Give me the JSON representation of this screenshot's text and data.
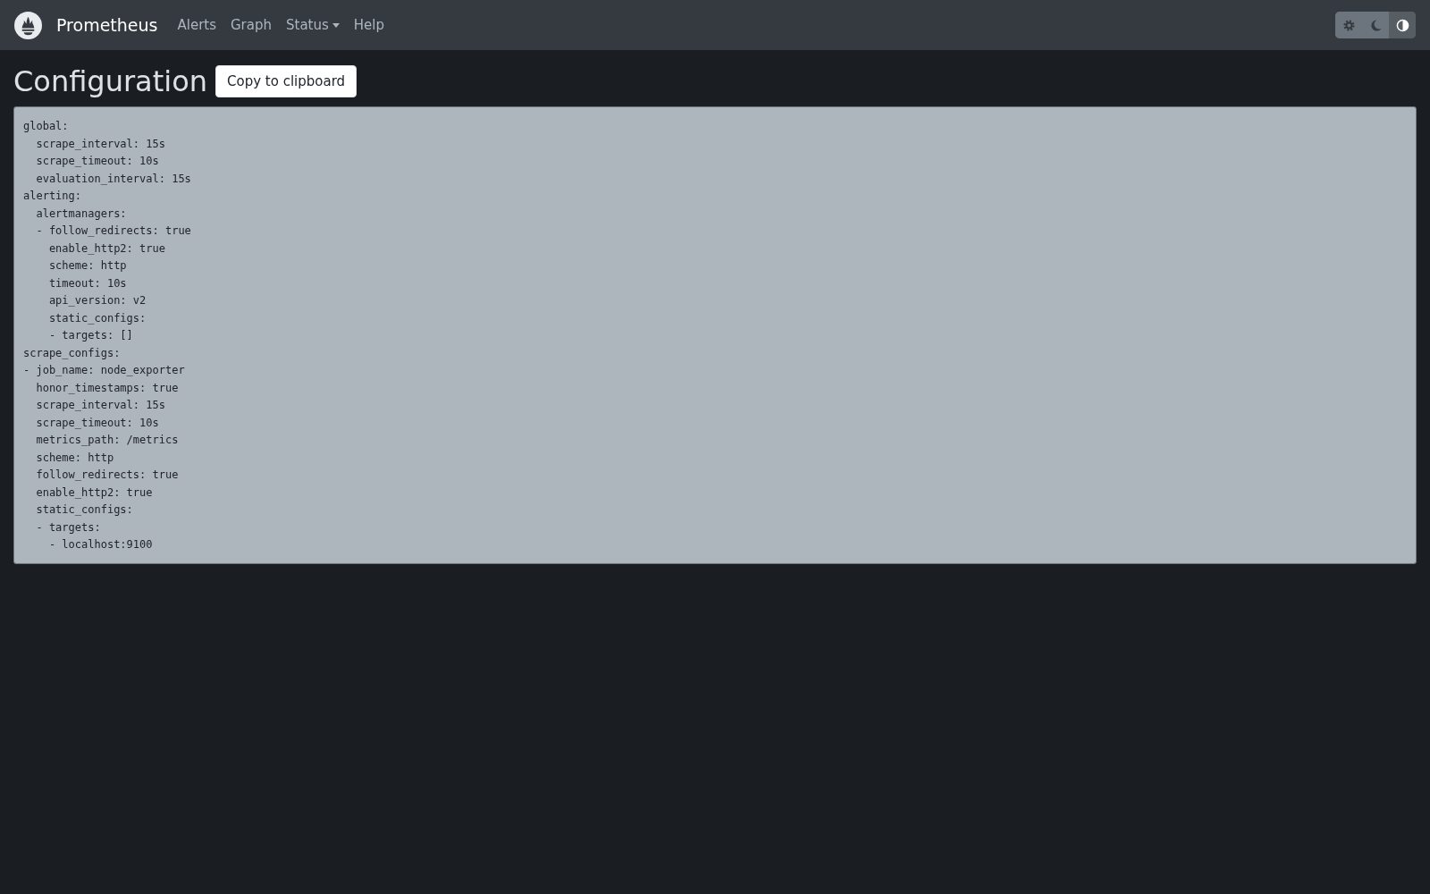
{
  "navbar": {
    "brand": "Prometheus",
    "links": [
      {
        "label": "Alerts",
        "kind": "link"
      },
      {
        "label": "Graph",
        "kind": "link"
      },
      {
        "label": "Status",
        "kind": "dropdown"
      },
      {
        "label": "Help",
        "kind": "link"
      }
    ],
    "theme_toggle": [
      {
        "kind": "light",
        "selected": false
      },
      {
        "kind": "dark",
        "selected": false
      },
      {
        "kind": "auto",
        "selected": true
      }
    ]
  },
  "page": {
    "title": "Configuration",
    "copy_button": "Copy to clipboard",
    "config_lines": [
      "global:",
      "  scrape_interval: 15s",
      "  scrape_timeout: 10s",
      "  evaluation_interval: 15s",
      "alerting:",
      "  alertmanagers:",
      "  - follow_redirects: true",
      "    enable_http2: true",
      "    scheme: http",
      "    timeout: 10s",
      "    api_version: v2",
      "    static_configs:",
      "    - targets: []",
      "scrape_configs:",
      "- job_name: node_exporter",
      "  honor_timestamps: true",
      "  scrape_interval: 15s",
      "  scrape_timeout: 10s",
      "  metrics_path: /metrics",
      "  scheme: http",
      "  follow_redirects: true",
      "  enable_http2: true",
      "  static_configs:",
      "  - targets:",
      "    - localhost:9100"
    ]
  }
}
